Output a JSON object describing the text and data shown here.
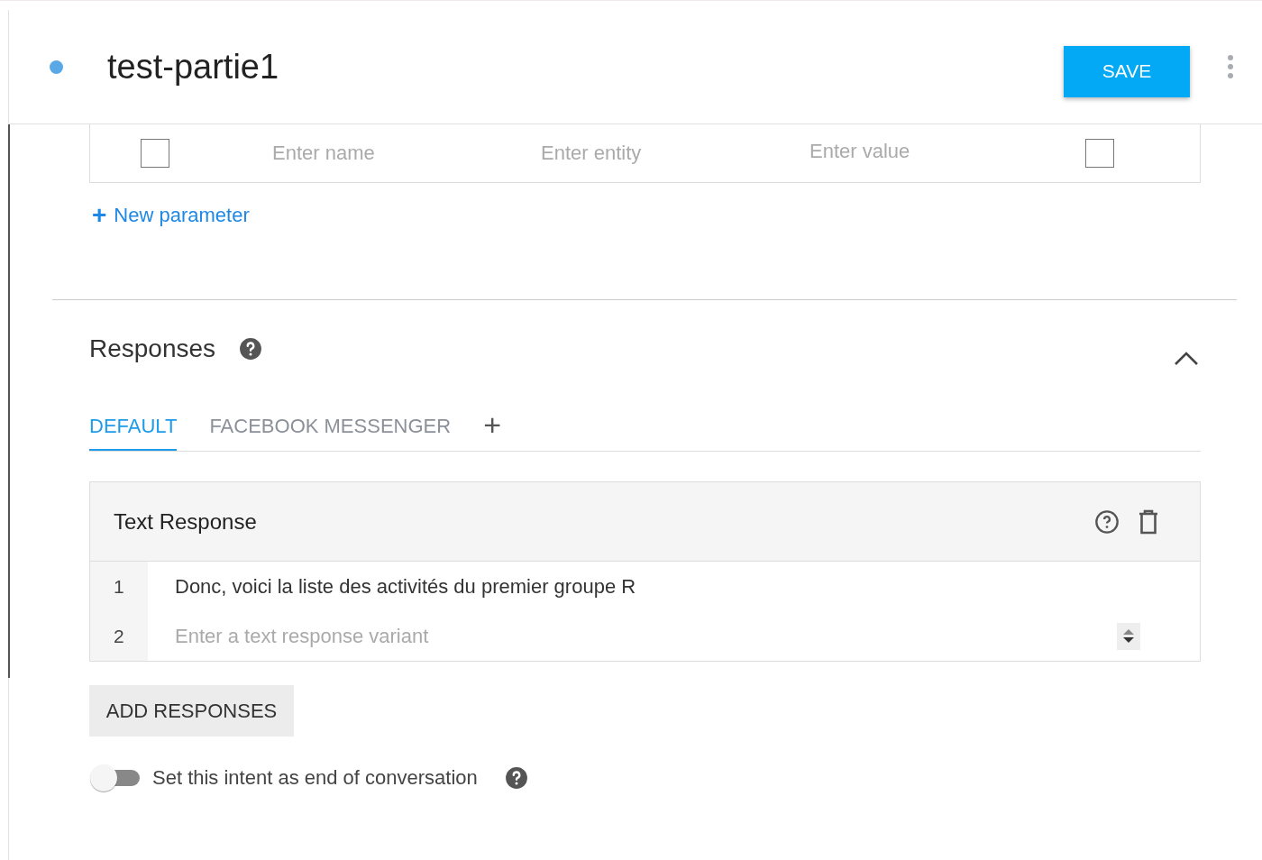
{
  "header": {
    "title": "test-partie1",
    "save_label": "SAVE"
  },
  "parameter_row": {
    "required": {
      "checked": false
    },
    "name": {
      "placeholder": "Enter name"
    },
    "entity": {
      "placeholder": "Enter entity"
    },
    "value": {
      "placeholder": "Enter value"
    },
    "is_list": {
      "checked": false
    }
  },
  "new_parameter": {
    "icon": "+",
    "label": "New parameter"
  },
  "responses": {
    "title": "Responses",
    "expanded": true,
    "tabs": [
      {
        "label": "DEFAULT",
        "selected": true
      },
      {
        "label": "FACEBOOK MESSENGER",
        "selected": false
      }
    ],
    "add_tab": "+",
    "card": {
      "title": "Text Response",
      "rows": [
        {
          "number": "1",
          "value": "Donc, voici la liste des activités du premier groupe R"
        },
        {
          "number": "2",
          "placeholder": "Enter a text response variant"
        }
      ]
    },
    "add_button": "ADD RESPONSES",
    "end_toggle": {
      "label": "Set this intent as end of conversation",
      "on": false
    }
  }
}
